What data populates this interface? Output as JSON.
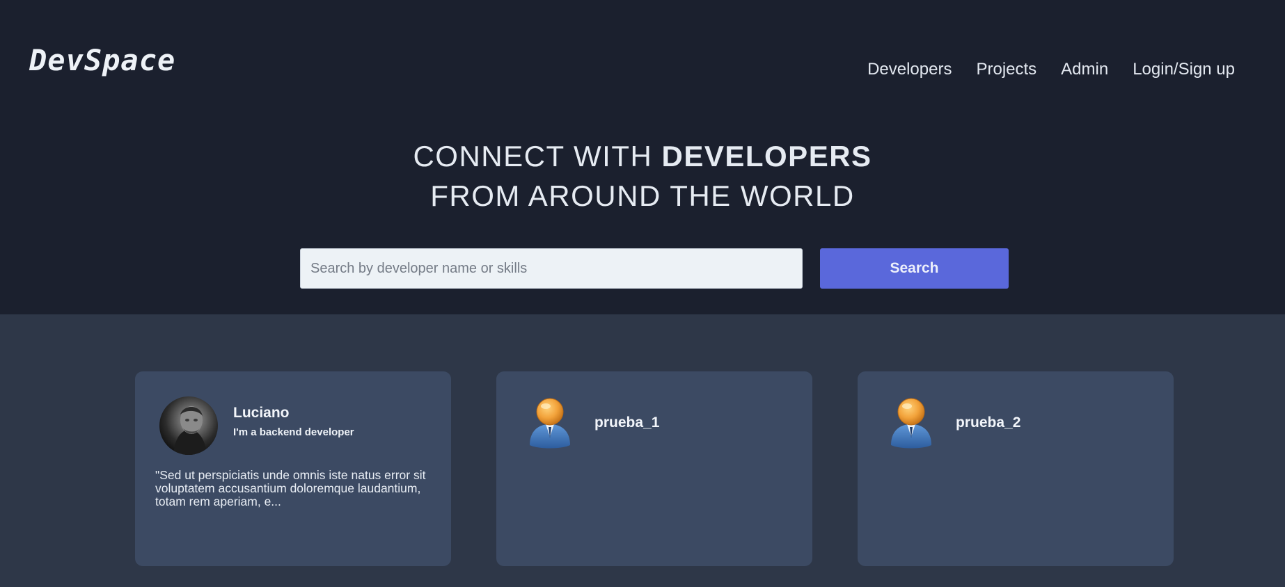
{
  "brand": {
    "logo": "DevSpace"
  },
  "nav": {
    "items": [
      {
        "label": "Developers"
      },
      {
        "label": "Projects"
      },
      {
        "label": "Admin"
      },
      {
        "label": "Login/Sign up"
      }
    ]
  },
  "hero": {
    "line1_prefix": "CONNECT WITH ",
    "line1_bold": "DEVELOPERS",
    "line2": "FROM AROUND THE WORLD"
  },
  "search": {
    "placeholder": "Search by developer name or skills",
    "value": "",
    "button_label": "Search"
  },
  "developers": [
    {
      "name": "Luciano",
      "tagline": "I'm a backend developer",
      "bio": "\"Sed ut perspiciatis unde omnis iste natus error sit voluptatem accusantium doloremque laudantium, totam rem aperiam, e...",
      "avatar": "profile-photo"
    },
    {
      "name": "prueba_1",
      "tagline": "",
      "bio": "",
      "avatar": "default-user-icon"
    },
    {
      "name": "prueba_2",
      "tagline": "",
      "bio": "",
      "avatar": "default-user-icon"
    }
  ],
  "colors": {
    "hero_bg": "#1b202e",
    "page_bg": "#2e3748",
    "card_bg": "#3c4a63",
    "accent": "#5a68db"
  }
}
